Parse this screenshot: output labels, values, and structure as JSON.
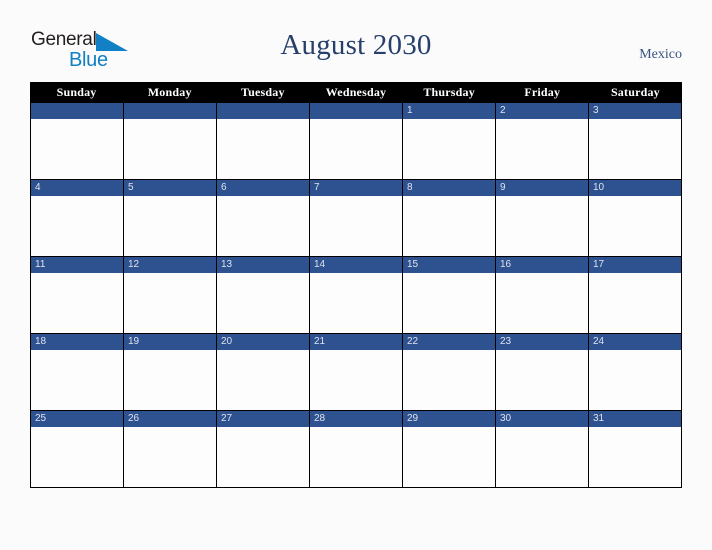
{
  "brand": {
    "name_part1": "General",
    "name_part2": "Blue",
    "triangle_icon": "triangle-icon",
    "color_dark": "#231f20",
    "color_blue": "#1180c4"
  },
  "header": {
    "title": "August 2030",
    "country": "Mexico",
    "title_color": "#27406b",
    "country_color": "#3b5280"
  },
  "calendar": {
    "month": "August",
    "year": "2030",
    "weekday_headers": [
      "Sunday",
      "Monday",
      "Tuesday",
      "Wednesday",
      "Thursday",
      "Friday",
      "Saturday"
    ],
    "header_bg": "#000000",
    "header_text_color": "#ffffff",
    "date_bar_color": "#2e5190",
    "date_text_color": "#dfe4ee",
    "cell_bg": "#fdfdfd",
    "weeks": [
      [
        {
          "date": ""
        },
        {
          "date": ""
        },
        {
          "date": ""
        },
        {
          "date": ""
        },
        {
          "date": "1"
        },
        {
          "date": "2"
        },
        {
          "date": "3"
        }
      ],
      [
        {
          "date": "4"
        },
        {
          "date": "5"
        },
        {
          "date": "6"
        },
        {
          "date": "7"
        },
        {
          "date": "8"
        },
        {
          "date": "9"
        },
        {
          "date": "10"
        }
      ],
      [
        {
          "date": "11"
        },
        {
          "date": "12"
        },
        {
          "date": "13"
        },
        {
          "date": "14"
        },
        {
          "date": "15"
        },
        {
          "date": "16"
        },
        {
          "date": "17"
        }
      ],
      [
        {
          "date": "18"
        },
        {
          "date": "19"
        },
        {
          "date": "20"
        },
        {
          "date": "21"
        },
        {
          "date": "22"
        },
        {
          "date": "23"
        },
        {
          "date": "24"
        }
      ],
      [
        {
          "date": "25"
        },
        {
          "date": "26"
        },
        {
          "date": "27"
        },
        {
          "date": "28"
        },
        {
          "date": "29"
        },
        {
          "date": "30"
        },
        {
          "date": "31"
        }
      ]
    ]
  }
}
